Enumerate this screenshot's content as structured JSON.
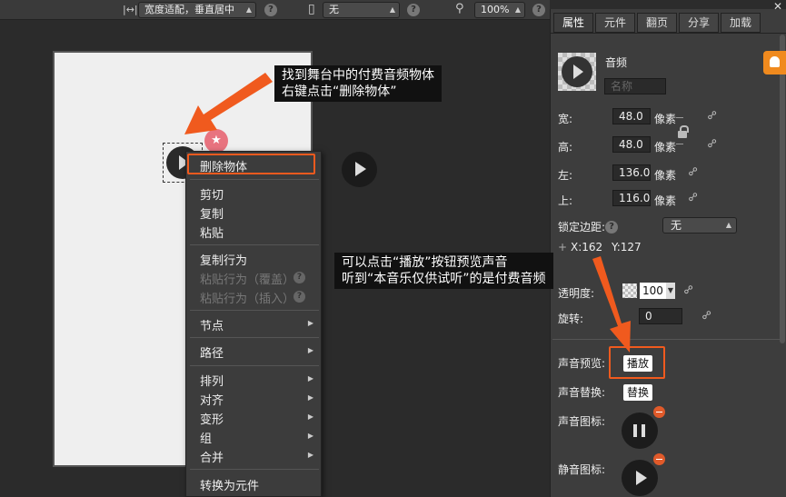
{
  "toolbar": {
    "fit_select": "宽度适配，垂直居中",
    "device_select": "无",
    "zoom_select": "100%",
    "help": "?"
  },
  "context_menu": {
    "delete_object": "删除物体",
    "cut": "剪切",
    "copy": "复制",
    "paste": "粘贴",
    "copy_behavior": "复制行为",
    "paste_behavior_overwrite": "粘贴行为（覆盖）",
    "paste_behavior_insert": "粘贴行为（插入）",
    "node": "节点",
    "path": "路径",
    "arrange": "排列",
    "align": "对齐",
    "transform": "变形",
    "group": "组",
    "merge": "合并",
    "convert_to_component": "转换为元件"
  },
  "callouts": {
    "find_delete": "找到舞台中的付费音频物体\n右键点击“删除物体”",
    "preview_sound": "可以点击“播放”按钮预览声音\n听到“本音乐仅供试听”的是付费音频"
  },
  "panel": {
    "tabs": [
      "属性",
      "元件",
      "翻页",
      "分享",
      "加载"
    ],
    "object_type": "音频",
    "name_placeholder": "名称",
    "width_label": "宽:",
    "width_value": "48.0",
    "height_label": "高:",
    "height_value": "48.0",
    "left_label": "左:",
    "left_value": "136.0",
    "top_label": "上:",
    "top_value": "116.0",
    "unit_px": "像素",
    "lock_margin_label": "锁定边距:",
    "lock_margin_value": "无",
    "pos_x": "X:162",
    "pos_y": "Y:127",
    "pos_plus": "+",
    "opacity_label": "透明度:",
    "opacity_value": "100",
    "rotation_label": "旋转:",
    "rotation_value": "0",
    "sound_preview_label": "声音预览:",
    "play_button": "播放",
    "sound_replace_label": "声音替换:",
    "replace_button": "替换",
    "sound_icon_label": "声音图标:",
    "mute_icon_label": "静音图标:"
  },
  "colors": {
    "highlight": "#f05a1e",
    "notification": "#f08a1e"
  }
}
